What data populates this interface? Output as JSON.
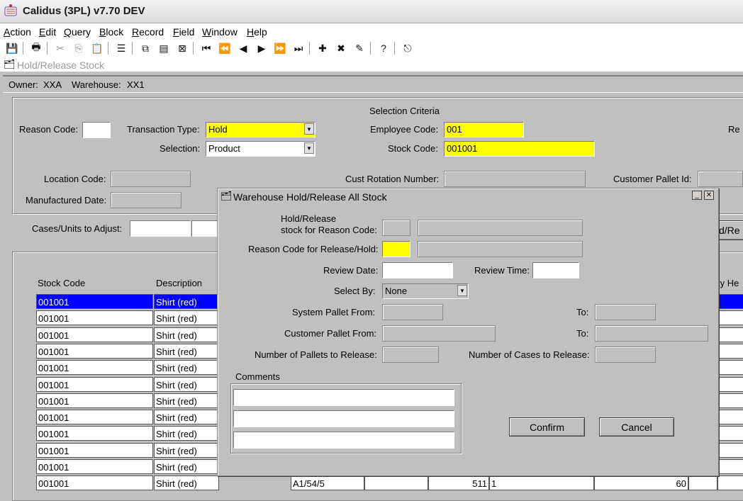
{
  "app": {
    "title": "Calidus (3PL) v7.70 DEV"
  },
  "menu": [
    {
      "label": "Action",
      "u": "A",
      "rest": "ction"
    },
    {
      "label": "Edit",
      "u": "E",
      "rest": "dit"
    },
    {
      "label": "Query",
      "u": "Q",
      "rest": "uery"
    },
    {
      "label": "Block",
      "u": "B",
      "rest": "lock"
    },
    {
      "label": "Record",
      "u": "R",
      "rest": "ecord"
    },
    {
      "label": "Field",
      "u": "F",
      "rest": "ield"
    },
    {
      "label": "Window",
      "u": "W",
      "rest": "indow"
    },
    {
      "label": "Help",
      "u": "H",
      "rest": "elp"
    }
  ],
  "form": {
    "title": "Hold/Release Stock"
  },
  "info": {
    "owner_label": "Owner:",
    "owner": "XXA",
    "warehouse_label": "Warehouse:",
    "warehouse": "XX1"
  },
  "criteria": {
    "heading": "Selection Criteria",
    "reason_code_label": "Reason Code:",
    "reason_code": "",
    "transaction_type_label": "Transaction Type:",
    "transaction_type": "Hold",
    "selection_label": "Selection:",
    "selection": "Product",
    "employee_code_label": "Employee Code:",
    "employee_code": "001",
    "stock_code_label": "Stock Code:",
    "stock_code": "001001",
    "right_cut_label": "Re",
    "location_code_label": "Location Code:",
    "cust_rotation_label": "Cust Rotation Number:",
    "customer_pallet_label": "Customer Pallet Id:",
    "manufactured_date_label": "Manufactured Date:",
    "cases_units_label": "Cases/Units to Adjust:",
    "right_button_cut": "d/Re"
  },
  "grid": {
    "headers": {
      "stock_code": "Stock Code",
      "description": "Description",
      "right_cut": "ty He"
    },
    "rows": [
      {
        "stock": "001001",
        "desc": "Shirt (red)"
      },
      {
        "stock": "001001",
        "desc": "Shirt (red)"
      },
      {
        "stock": "001001",
        "desc": "Shirt (red)"
      },
      {
        "stock": "001001",
        "desc": "Shirt (red)"
      },
      {
        "stock": "001001",
        "desc": "Shirt (red)"
      },
      {
        "stock": "001001",
        "desc": "Shirt (red)"
      },
      {
        "stock": "001001",
        "desc": "Shirt (red)"
      },
      {
        "stock": "001001",
        "desc": "Shirt (red)"
      },
      {
        "stock": "001001",
        "desc": "Shirt (red)"
      },
      {
        "stock": "001001",
        "desc": "Shirt (red)"
      },
      {
        "stock": "001001",
        "desc": "Shirt (red)"
      },
      {
        "stock": "001001",
        "desc": "Shirt (red)",
        "location": "A1/54/5",
        "qty": "511",
        "col6": "1",
        "col7": "60"
      }
    ]
  },
  "modal": {
    "title": "Warehouse Hold/Release All Stock",
    "hold_release_label_1": "Hold/Release",
    "hold_release_label_2": "stock for Reason Code:",
    "reason_release_hold_label": "Reason Code for Release/Hold:",
    "review_date_label": "Review Date:",
    "review_time_label": "Review Time:",
    "select_by_label": "Select By:",
    "select_by": "None",
    "system_pallet_from_label": "System Pallet From:",
    "to_label_1": "To:",
    "customer_pallet_from_label": "Customer Pallet From:",
    "to_label_2": "To:",
    "num_pallets_label": "Number of Pallets to Release:",
    "num_cases_label": "Number of Cases to Release:",
    "comments_label": "Comments",
    "confirm_label": "Confirm",
    "cancel_label": "Cancel"
  },
  "colors": {
    "selected_row": "#0000ff",
    "required_field": "#ffff00",
    "window_bg": "#c0c0c0"
  }
}
